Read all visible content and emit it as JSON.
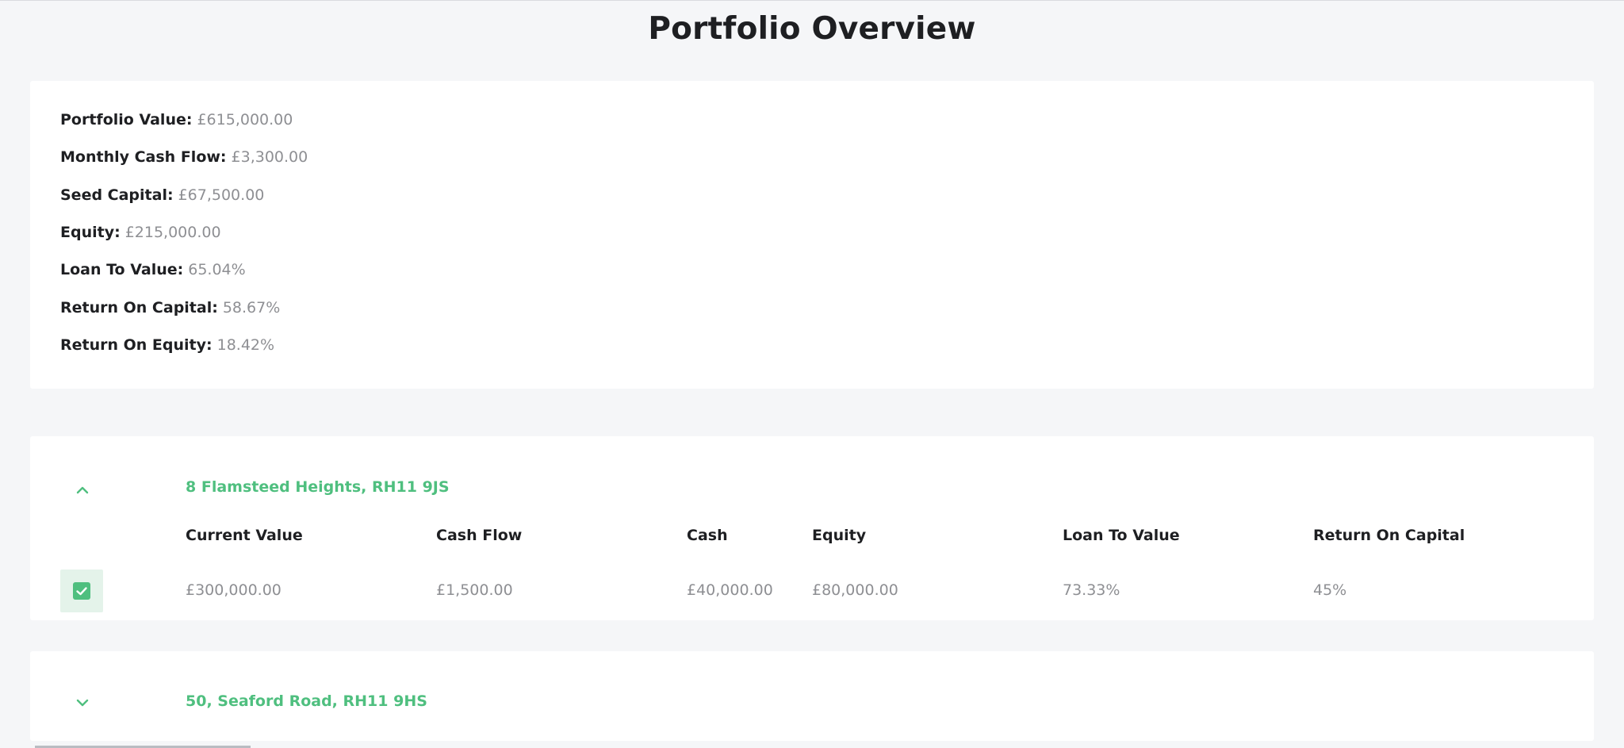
{
  "page": {
    "title": "Portfolio Overview"
  },
  "summary": {
    "items": [
      {
        "label": "Portfolio Value:",
        "value": "£615,000.00"
      },
      {
        "label": "Monthly Cash Flow:",
        "value": "£3,300.00"
      },
      {
        "label": "Seed Capital:",
        "value": "£67,500.00"
      },
      {
        "label": "Equity:",
        "value": "£215,000.00"
      },
      {
        "label": "Loan To Value:",
        "value": "65.04%"
      },
      {
        "label": "Return On Capital:",
        "value": "58.67%"
      },
      {
        "label": "Return On Equity:",
        "value": "18.42%"
      }
    ]
  },
  "properties": [
    {
      "address": "8 Flamsteed Heights, RH11 9JS",
      "expanded": true,
      "expand_icon": "chevron-up-icon",
      "selected": true,
      "columns": [
        "Current Value",
        "Cash Flow",
        "Cash",
        "Equity",
        "Loan To Value",
        "Return On Capital"
      ],
      "values": [
        "£300,000.00",
        "£1,500.00",
        "£40,000.00",
        "£80,000.00",
        "73.33%",
        "45%"
      ]
    },
    {
      "address": "50, Seaford Road, RH11 9HS",
      "expanded": false,
      "expand_icon": "chevron-down-icon"
    }
  ],
  "colors": {
    "accent": "#4fbf7f",
    "muted_text": "#8e8f93",
    "background": "#f5f6f8"
  }
}
